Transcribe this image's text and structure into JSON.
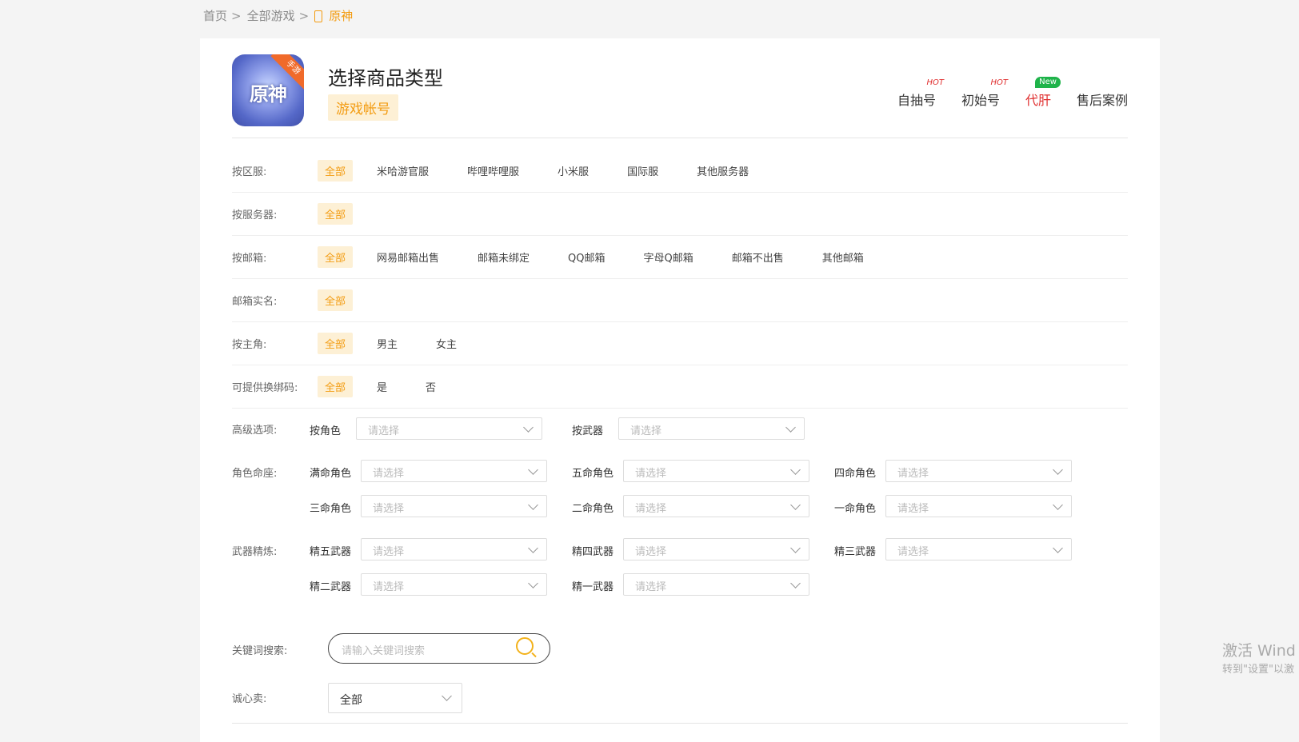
{
  "breadcrumb": {
    "home": "首页",
    "all_games": "全部游戏",
    "current": "原神"
  },
  "header": {
    "logo_text": "原神",
    "logo_ribbon": "手游",
    "title": "选择商品类型",
    "tag": "游戏帐号"
  },
  "tabs": [
    {
      "label": "自抽号",
      "badge": "HOT"
    },
    {
      "label": "初始号",
      "badge": "HOT"
    },
    {
      "label": "代肝",
      "badge": "New"
    },
    {
      "label": "售后案例",
      "badge": ""
    }
  ],
  "filters": [
    {
      "label": "按区服:",
      "options": [
        "全部",
        "米哈游官服",
        "哔哩哔哩服",
        "小米服",
        "国际服",
        "其他服务器"
      ]
    },
    {
      "label": "按服务器:",
      "options": [
        "全部"
      ]
    },
    {
      "label": "按邮箱:",
      "options": [
        "全部",
        "网易邮箱出售",
        "邮箱未绑定",
        "QQ邮箱",
        "字母Q邮箱",
        "邮箱不出售",
        "其他邮箱"
      ]
    },
    {
      "label": "邮箱实名:",
      "options": [
        "全部"
      ]
    },
    {
      "label": "按主角:",
      "options": [
        "全部",
        "男主",
        "女主"
      ]
    },
    {
      "label": "可提供换绑码:",
      "options": [
        "全部",
        "是",
        "否"
      ]
    }
  ],
  "advanced": {
    "label": "高级选项:",
    "role_label": "按角色",
    "weapon_label": "按武器",
    "placeholder": "请选择"
  },
  "constellation": {
    "label": "角色命座:",
    "items": [
      "满命角色",
      "五命角色",
      "四命角色",
      "三命角色",
      "二命角色",
      "一命角色"
    ]
  },
  "refine": {
    "label": "武器精炼:",
    "items": [
      "精五武器",
      "精四武器",
      "精三武器",
      "精二武器",
      "精一武器"
    ]
  },
  "search": {
    "label": "关键词搜索:",
    "placeholder": "请输入关键词搜索"
  },
  "sincere": {
    "label": "诚心卖:",
    "value": "全部"
  },
  "watermark": {
    "line1": "激活 Wind",
    "line2": "转到\"设置\"以激"
  }
}
